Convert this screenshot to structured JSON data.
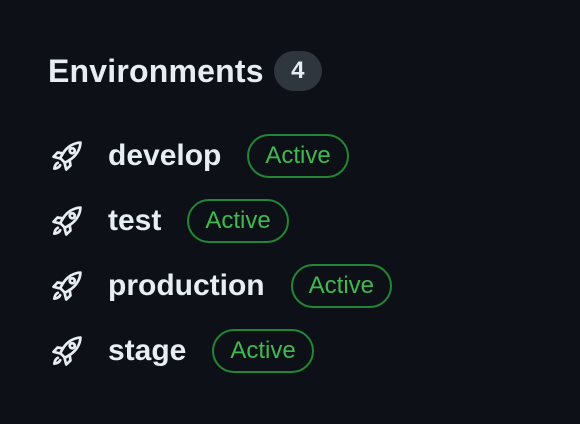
{
  "environments": {
    "title": "Environments",
    "count": "4",
    "items": [
      {
        "name": "develop",
        "status": "Active",
        "icon": "rocket-icon"
      },
      {
        "name": "test",
        "status": "Active",
        "icon": "rocket-icon"
      },
      {
        "name": "production",
        "status": "Active",
        "icon": "rocket-icon"
      },
      {
        "name": "stage",
        "status": "Active",
        "icon": "rocket-icon"
      }
    ]
  },
  "colors": {
    "background": "#0d1117",
    "text": "#e6edf3",
    "count_badge_bg": "#30363d",
    "active_border": "#238636",
    "active_text": "#3fb950"
  }
}
